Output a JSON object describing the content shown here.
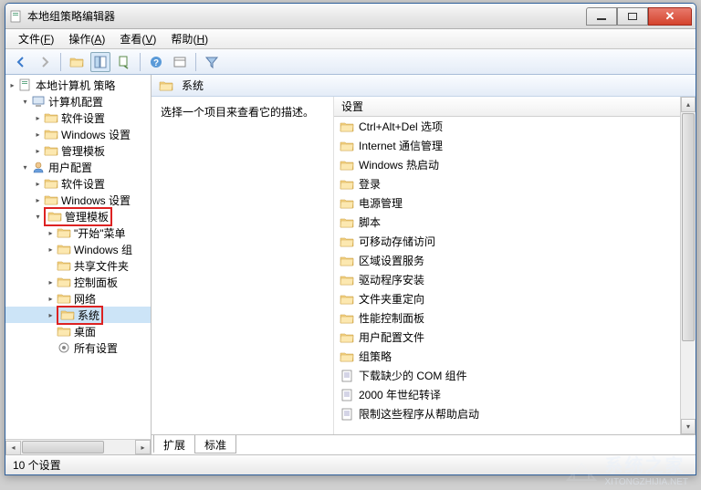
{
  "window": {
    "title": "本地组策略编辑器"
  },
  "menubar": [
    {
      "label": "文件",
      "key": "F"
    },
    {
      "label": "操作",
      "key": "A"
    },
    {
      "label": "查看",
      "key": "V"
    },
    {
      "label": "帮助",
      "key": "H"
    }
  ],
  "tree": {
    "root_label": "本地计算机 策略",
    "nodes": [
      {
        "indent": 0,
        "toggle": "▸",
        "icon": "root",
        "label": "本地计算机 策略"
      },
      {
        "indent": 1,
        "toggle": "▾",
        "icon": "computer",
        "label": "计算机配置"
      },
      {
        "indent": 2,
        "toggle": "▸",
        "icon": "folder",
        "label": "软件设置"
      },
      {
        "indent": 2,
        "toggle": "▸",
        "icon": "folder",
        "label": "Windows 设置"
      },
      {
        "indent": 2,
        "toggle": "▸",
        "icon": "folder",
        "label": "管理模板"
      },
      {
        "indent": 1,
        "toggle": "▾",
        "icon": "user",
        "label": "用户配置"
      },
      {
        "indent": 2,
        "toggle": "▸",
        "icon": "folder",
        "label": "软件设置"
      },
      {
        "indent": 2,
        "toggle": "▸",
        "icon": "folder",
        "label": "Windows 设置"
      },
      {
        "indent": 2,
        "toggle": "▾",
        "icon": "folder",
        "label": "管理模板",
        "highlight": true
      },
      {
        "indent": 3,
        "toggle": "▸",
        "icon": "folder",
        "label": "\"开始\"菜单"
      },
      {
        "indent": 3,
        "toggle": "▸",
        "icon": "folder",
        "label": "Windows 组"
      },
      {
        "indent": 3,
        "toggle": "",
        "icon": "folder",
        "label": "共享文件夹"
      },
      {
        "indent": 3,
        "toggle": "▸",
        "icon": "folder",
        "label": "控制面板"
      },
      {
        "indent": 3,
        "toggle": "▸",
        "icon": "folder",
        "label": "网络"
      },
      {
        "indent": 3,
        "toggle": "▸",
        "icon": "folder",
        "label": "系统",
        "highlight": true,
        "selected": true
      },
      {
        "indent": 3,
        "toggle": "",
        "icon": "folder",
        "label": "桌面"
      },
      {
        "indent": 3,
        "toggle": "",
        "icon": "settings",
        "label": "所有设置"
      }
    ]
  },
  "main": {
    "header_label": "系统",
    "description": "选择一个项目来查看它的描述。",
    "column_header": "设置",
    "items": [
      {
        "icon": "folder",
        "label": "Ctrl+Alt+Del 选项"
      },
      {
        "icon": "folder",
        "label": "Internet 通信管理"
      },
      {
        "icon": "folder",
        "label": "Windows 热启动"
      },
      {
        "icon": "folder",
        "label": "登录"
      },
      {
        "icon": "folder",
        "label": "电源管理"
      },
      {
        "icon": "folder",
        "label": "脚本"
      },
      {
        "icon": "folder",
        "label": "可移动存储访问"
      },
      {
        "icon": "folder",
        "label": "区域设置服务"
      },
      {
        "icon": "folder",
        "label": "驱动程序安装"
      },
      {
        "icon": "folder",
        "label": "文件夹重定向"
      },
      {
        "icon": "folder",
        "label": "性能控制面板"
      },
      {
        "icon": "folder",
        "label": "用户配置文件"
      },
      {
        "icon": "folder",
        "label": "组策略"
      },
      {
        "icon": "doc",
        "label": "下载缺少的 COM 组件"
      },
      {
        "icon": "doc",
        "label": "2000 年世纪转译"
      },
      {
        "icon": "doc",
        "label": "限制这些程序从帮助启动"
      }
    ]
  },
  "tabs": [
    {
      "label": "扩展",
      "active": true
    },
    {
      "label": "标准",
      "active": false
    }
  ],
  "statusbar": "10 个设置",
  "watermark": {
    "text": "系统之家",
    "url": "XITONGZHIJIA.NET"
  }
}
